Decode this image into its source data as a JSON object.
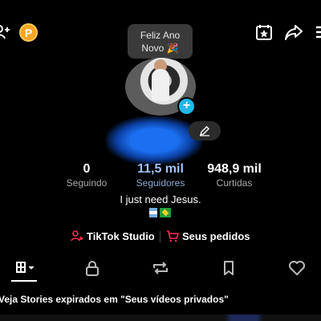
{
  "header": {
    "coin_letter": "P",
    "icons": [
      "add-user-icon",
      "coin-icon",
      "calendar-star-icon",
      "share-icon",
      "menu-icon"
    ]
  },
  "bubble": {
    "line1": "Feliz Ano",
    "line2": "Novo 🎉"
  },
  "profile": {
    "add_badge": "+",
    "stats": [
      {
        "value": "0",
        "label": "Seguindo"
      },
      {
        "value": "11,5 mil",
        "label": "Seguidores"
      },
      {
        "value": "948,9 mil",
        "label": "Curtidas"
      }
    ],
    "bio": "I just need Jesus."
  },
  "links": {
    "studio": "TikTok Studio",
    "orders": "Seus pedidos"
  },
  "tabs": [
    "grid-icon",
    "lock-icon",
    "repost-icon",
    "bookmark-icon",
    "heart-icon"
  ],
  "notice": "Veja Stories expirados em \"Seus vídeos privados\"",
  "colors": {
    "accent_red": "#fe2c55",
    "plus_badge": "#20b7e8",
    "coin": "#f5a623"
  }
}
